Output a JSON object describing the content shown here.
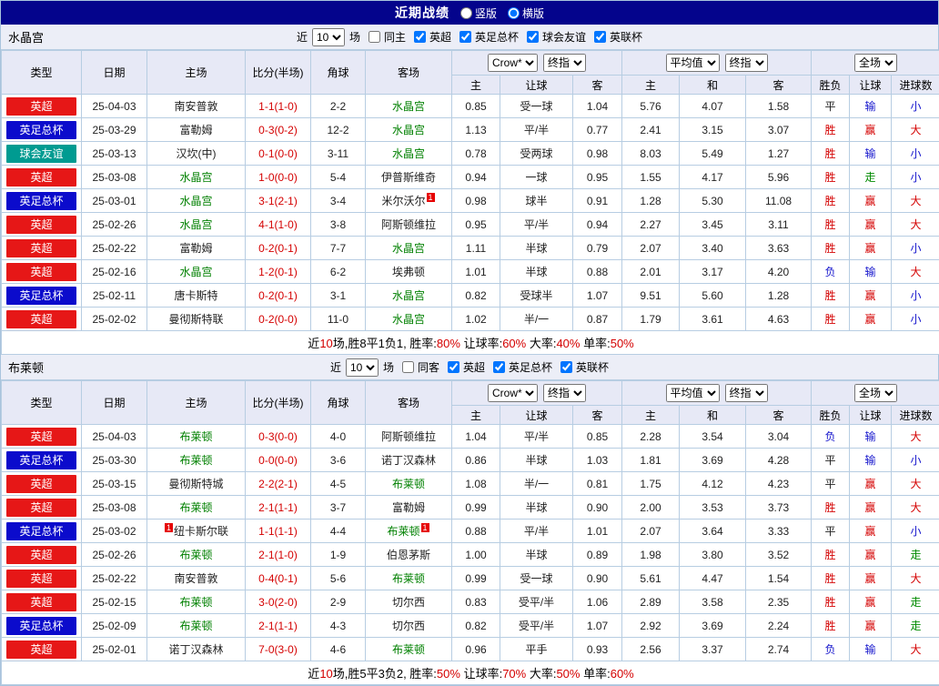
{
  "page": {
    "title": "近期战绩",
    "layout_options": [
      {
        "label": "竖版",
        "selected": false
      },
      {
        "label": "横版",
        "selected": true
      }
    ]
  },
  "colors": {
    "league": {
      "英超": "#e61717",
      "英足总杯": "#0b0bcc",
      "球会友谊": "#009b91"
    },
    "result": {
      "胜": "#d40000",
      "负": "#1414cc",
      "平": "#222222",
      "赢": "#d40000",
      "输": "#1414cc",
      "走": "#008a00",
      "大": "#d40000",
      "小": "#1414cc"
    },
    "team_highlight": "#008000",
    "score": "#d40000",
    "card": "#e60000"
  },
  "table_header": {
    "main_cols": [
      "类型",
      "日期",
      "主场",
      "比分(半场)",
      "角球",
      "客场"
    ],
    "odds_groups": [
      {
        "selects": [
          "Crow*",
          "终指"
        ],
        "sub": [
          "主",
          "让球",
          "客"
        ]
      },
      {
        "selects": [
          "平均值",
          "终指"
        ],
        "sub": [
          "主",
          "和",
          "客"
        ]
      },
      {
        "selects": [
          "全场"
        ],
        "sub": [
          "胜负",
          "让球",
          "进球数"
        ]
      }
    ]
  },
  "sections": [
    {
      "team": "水晶宫",
      "filters": {
        "prefix": "近",
        "count": "10",
        "suffix": "场",
        "venue": {
          "label": "同主",
          "checked": false
        },
        "leagues": [
          {
            "label": "英超",
            "checked": true
          },
          {
            "label": "英足总杯",
            "checked": true
          },
          {
            "label": "球会友谊",
            "checked": true
          },
          {
            "label": "英联杯",
            "checked": true
          }
        ]
      },
      "rows": [
        {
          "league": "英超",
          "date": "25-04-03",
          "home": {
            "name": "南安普敦"
          },
          "score": "1-1(1-0)",
          "corner": "2-2",
          "away": {
            "name": "水晶宫",
            "green": true
          },
          "odds": [
            "0.85",
            "受一球",
            "1.04",
            "5.76",
            "4.07",
            "1.58"
          ],
          "results": [
            "平",
            "输",
            "小"
          ]
        },
        {
          "league": "英足总杯",
          "date": "25-03-29",
          "home": {
            "name": "富勒姆"
          },
          "score": "0-3(0-2)",
          "corner": "12-2",
          "away": {
            "name": "水晶宫",
            "green": true
          },
          "odds": [
            "1.13",
            "平/半",
            "0.77",
            "2.41",
            "3.15",
            "3.07"
          ],
          "results": [
            "胜",
            "赢",
            "大"
          ]
        },
        {
          "league": "球会友谊",
          "date": "25-03-13",
          "home": {
            "name": "汉坎(中)"
          },
          "score": "0-1(0-0)",
          "corner": "3-11",
          "away": {
            "name": "水晶宫",
            "green": true
          },
          "odds": [
            "0.78",
            "受两球",
            "0.98",
            "8.03",
            "5.49",
            "1.27"
          ],
          "results": [
            "胜",
            "输",
            "小"
          ]
        },
        {
          "league": "英超",
          "date": "25-03-08",
          "home": {
            "name": "水晶宫",
            "green": true
          },
          "score": "1-0(0-0)",
          "corner": "5-4",
          "away": {
            "name": "伊普斯维奇"
          },
          "odds": [
            "0.94",
            "一球",
            "0.95",
            "1.55",
            "4.17",
            "5.96"
          ],
          "results": [
            "胜",
            "走",
            "小"
          ]
        },
        {
          "league": "英足总杯",
          "date": "25-03-01",
          "home": {
            "name": "水晶宫",
            "green": true
          },
          "score": "3-1(2-1)",
          "corner": "3-4",
          "away": {
            "name": "米尔沃尔",
            "card_post": "1"
          },
          "odds": [
            "0.98",
            "球半",
            "0.91",
            "1.28",
            "5.30",
            "11.08"
          ],
          "results": [
            "胜",
            "赢",
            "大"
          ]
        },
        {
          "league": "英超",
          "date": "25-02-26",
          "home": {
            "name": "水晶宫",
            "green": true
          },
          "score": "4-1(1-0)",
          "corner": "3-8",
          "away": {
            "name": "阿斯顿维拉"
          },
          "odds": [
            "0.95",
            "平/半",
            "0.94",
            "2.27",
            "3.45",
            "3.11"
          ],
          "results": [
            "胜",
            "赢",
            "大"
          ]
        },
        {
          "league": "英超",
          "date": "25-02-22",
          "home": {
            "name": "富勒姆"
          },
          "score": "0-2(0-1)",
          "corner": "7-7",
          "away": {
            "name": "水晶宫",
            "green": true
          },
          "odds": [
            "1.11",
            "半球",
            "0.79",
            "2.07",
            "3.40",
            "3.63"
          ],
          "results": [
            "胜",
            "赢",
            "小"
          ]
        },
        {
          "league": "英超",
          "date": "25-02-16",
          "home": {
            "name": "水晶宫",
            "green": true
          },
          "score": "1-2(0-1)",
          "corner": "6-2",
          "away": {
            "name": "埃弗顿"
          },
          "odds": [
            "1.01",
            "半球",
            "0.88",
            "2.01",
            "3.17",
            "4.20"
          ],
          "results": [
            "负",
            "输",
            "大"
          ]
        },
        {
          "league": "英足总杯",
          "date": "25-02-11",
          "home": {
            "name": "唐卡斯特"
          },
          "score": "0-2(0-1)",
          "corner": "3-1",
          "away": {
            "name": "水晶宫",
            "green": true
          },
          "odds": [
            "0.82",
            "受球半",
            "1.07",
            "9.51",
            "5.60",
            "1.28"
          ],
          "results": [
            "胜",
            "赢",
            "小"
          ]
        },
        {
          "league": "英超",
          "date": "25-02-02",
          "home": {
            "name": "曼彻斯特联"
          },
          "score": "0-2(0-0)",
          "corner": "11-0",
          "away": {
            "name": "水晶宫",
            "green": true
          },
          "odds": [
            "1.02",
            "半/一",
            "0.87",
            "1.79",
            "3.61",
            "4.63"
          ],
          "results": [
            "胜",
            "赢",
            "小"
          ]
        }
      ],
      "summary": [
        {
          "text": "近",
          "red": false
        },
        {
          "text": "10",
          "red": true
        },
        {
          "text": "场,胜8平1负1, 胜率:",
          "red": false
        },
        {
          "text": "80%",
          "red": true
        },
        {
          "text": " 让球率:",
          "red": false
        },
        {
          "text": "60%",
          "red": true
        },
        {
          "text": " 大率:",
          "red": false
        },
        {
          "text": "40%",
          "red": true
        },
        {
          "text": " 单率:",
          "red": false
        },
        {
          "text": "50%",
          "red": true
        }
      ]
    },
    {
      "team": "布莱顿",
      "filters": {
        "prefix": "近",
        "count": "10",
        "suffix": "场",
        "venue": {
          "label": "同客",
          "checked": false
        },
        "leagues": [
          {
            "label": "英超",
            "checked": true
          },
          {
            "label": "英足总杯",
            "checked": true
          },
          {
            "label": "英联杯",
            "checked": true
          }
        ]
      },
      "rows": [
        {
          "league": "英超",
          "date": "25-04-03",
          "home": {
            "name": "布莱顿",
            "green": true
          },
          "score": "0-3(0-0)",
          "corner": "4-0",
          "away": {
            "name": "阿斯顿维拉"
          },
          "odds": [
            "1.04",
            "平/半",
            "0.85",
            "2.28",
            "3.54",
            "3.04"
          ],
          "results": [
            "负",
            "输",
            "大"
          ]
        },
        {
          "league": "英足总杯",
          "date": "25-03-30",
          "home": {
            "name": "布莱顿",
            "green": true
          },
          "score": "0-0(0-0)",
          "corner": "3-6",
          "away": {
            "name": "诺丁汉森林"
          },
          "odds": [
            "0.86",
            "半球",
            "1.03",
            "1.81",
            "3.69",
            "4.28"
          ],
          "results": [
            "平",
            "输",
            "小"
          ]
        },
        {
          "league": "英超",
          "date": "25-03-15",
          "home": {
            "name": "曼彻斯特城"
          },
          "score": "2-2(2-1)",
          "corner": "4-5",
          "away": {
            "name": "布莱顿",
            "green": true
          },
          "odds": [
            "1.08",
            "半/一",
            "0.81",
            "1.75",
            "4.12",
            "4.23"
          ],
          "results": [
            "平",
            "赢",
            "大"
          ]
        },
        {
          "league": "英超",
          "date": "25-03-08",
          "home": {
            "name": "布莱顿",
            "green": true
          },
          "score": "2-1(1-1)",
          "corner": "3-7",
          "away": {
            "name": "富勒姆"
          },
          "odds": [
            "0.99",
            "半球",
            "0.90",
            "2.00",
            "3.53",
            "3.73"
          ],
          "results": [
            "胜",
            "赢",
            "大"
          ]
        },
        {
          "league": "英足总杯",
          "date": "25-03-02",
          "home": {
            "name": "纽卡斯尔联",
            "card_pre": "1"
          },
          "score": "1-1(1-1)",
          "corner": "4-4",
          "away": {
            "name": "布莱顿",
            "green": true,
            "card_post": "1"
          },
          "odds": [
            "0.88",
            "平/半",
            "1.01",
            "2.07",
            "3.64",
            "3.33"
          ],
          "results": [
            "平",
            "赢",
            "小"
          ]
        },
        {
          "league": "英超",
          "date": "25-02-26",
          "home": {
            "name": "布莱顿",
            "green": true
          },
          "score": "2-1(1-0)",
          "corner": "1-9",
          "away": {
            "name": "伯恩茅斯"
          },
          "odds": [
            "1.00",
            "半球",
            "0.89",
            "1.98",
            "3.80",
            "3.52"
          ],
          "results": [
            "胜",
            "赢",
            "走"
          ]
        },
        {
          "league": "英超",
          "date": "25-02-22",
          "home": {
            "name": "南安普敦"
          },
          "score": "0-4(0-1)",
          "corner": "5-6",
          "away": {
            "name": "布莱顿",
            "green": true
          },
          "odds": [
            "0.99",
            "受一球",
            "0.90",
            "5.61",
            "4.47",
            "1.54"
          ],
          "results": [
            "胜",
            "赢",
            "大"
          ]
        },
        {
          "league": "英超",
          "date": "25-02-15",
          "home": {
            "name": "布莱顿",
            "green": true
          },
          "score": "3-0(2-0)",
          "corner": "2-9",
          "away": {
            "name": "切尔西"
          },
          "odds": [
            "0.83",
            "受平/半",
            "1.06",
            "2.89",
            "3.58",
            "2.35"
          ],
          "results": [
            "胜",
            "赢",
            "走"
          ]
        },
        {
          "league": "英足总杯",
          "date": "25-02-09",
          "home": {
            "name": "布莱顿",
            "green": true
          },
          "score": "2-1(1-1)",
          "corner": "4-3",
          "away": {
            "name": "切尔西"
          },
          "odds": [
            "0.82",
            "受平/半",
            "1.07",
            "2.92",
            "3.69",
            "2.24"
          ],
          "results": [
            "胜",
            "赢",
            "走"
          ]
        },
        {
          "league": "英超",
          "date": "25-02-01",
          "home": {
            "name": "诺丁汉森林"
          },
          "score": "7-0(3-0)",
          "corner": "4-6",
          "away": {
            "name": "布莱顿",
            "green": true
          },
          "odds": [
            "0.96",
            "平手",
            "0.93",
            "2.56",
            "3.37",
            "2.74"
          ],
          "results": [
            "负",
            "输",
            "大"
          ]
        }
      ],
      "summary": [
        {
          "text": "近",
          "red": false
        },
        {
          "text": "10",
          "red": true
        },
        {
          "text": "场,胜5平3负2, 胜率:",
          "red": false
        },
        {
          "text": "50%",
          "red": true
        },
        {
          "text": " 让球率:",
          "red": false
        },
        {
          "text": "70%",
          "red": true
        },
        {
          "text": " 大率:",
          "red": false
        },
        {
          "text": "50%",
          "red": true
        },
        {
          "text": " 单率:",
          "red": false
        },
        {
          "text": "60%",
          "red": true
        }
      ]
    }
  ]
}
